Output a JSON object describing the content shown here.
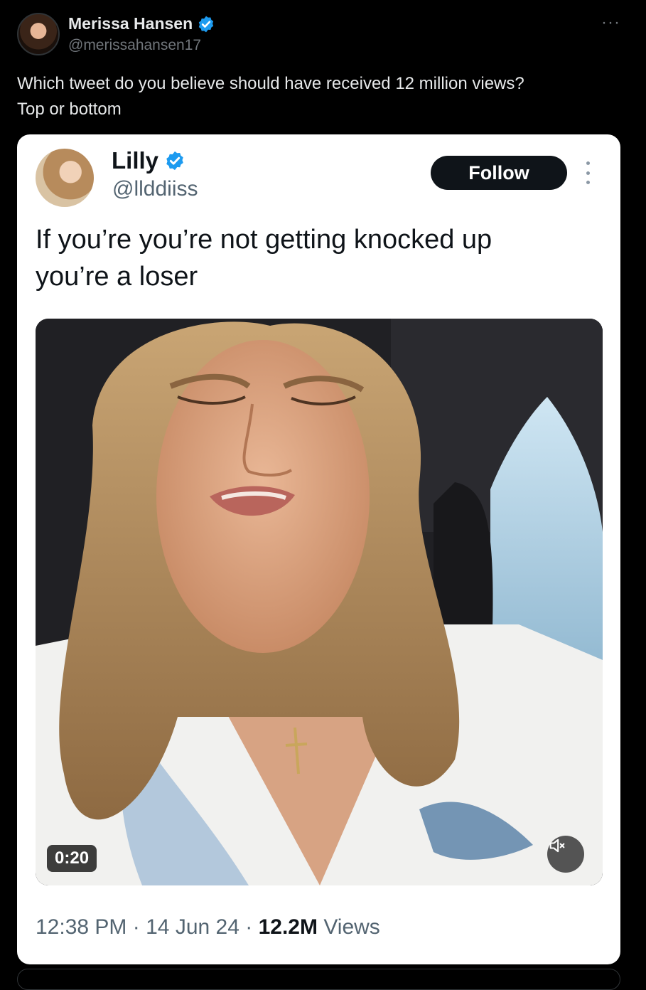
{
  "tweet": {
    "author": {
      "name": "Merissa Hansen",
      "handle": "@merissahansen17",
      "verified": true
    },
    "more_label": "···",
    "text_lines": [
      "Which tweet do you believe should have received 12 million views?",
      "Top or bottom"
    ]
  },
  "quoted_screenshot": {
    "author": {
      "name": "Lilly",
      "handle": "@llddiiss",
      "verified": true
    },
    "follow_label": "Follow",
    "text_lines": [
      "If you’re you’re not getting knocked up",
      "you’re a loser"
    ],
    "video": {
      "duration": "0:20",
      "muted": true
    },
    "meta": {
      "time": "12:38 PM",
      "separator": "·",
      "date": "14 Jun 24",
      "views_count": "12.2M",
      "views_label": "Views"
    }
  },
  "colors": {
    "background": "#000000",
    "verified_blue": "#1d9bf0",
    "card_background": "#ffffff",
    "follow_button": "#0f1419"
  }
}
